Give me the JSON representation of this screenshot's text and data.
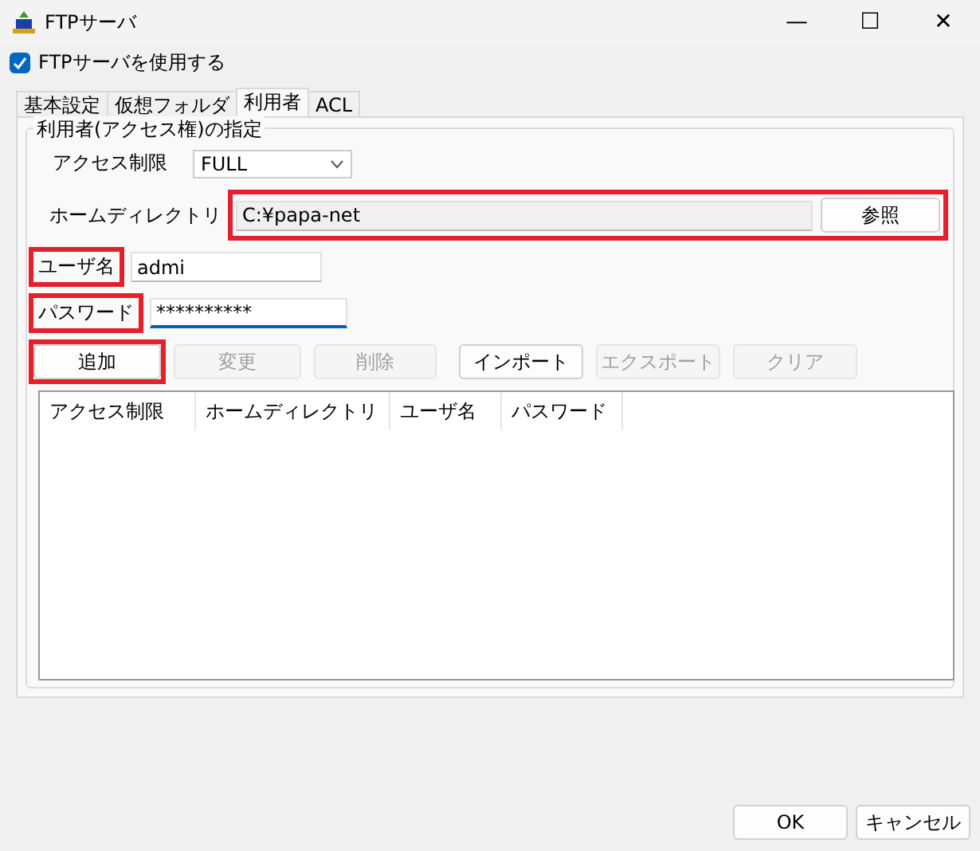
{
  "window": {
    "title": "FTPサーバ",
    "minimize": "—",
    "maximize": "☐",
    "close": "✕"
  },
  "enable": {
    "label": "FTPサーバを使用する",
    "checked": true
  },
  "tabs": [
    {
      "label": "基本設定",
      "selected": false
    },
    {
      "label": "仮想フォルダ",
      "selected": false
    },
    {
      "label": "利用者",
      "selected": true
    },
    {
      "label": "ACL",
      "selected": false
    }
  ],
  "group": {
    "title": "利用者(アクセス権)の指定",
    "access": {
      "label": "アクセス制限",
      "value": "FULL"
    },
    "home": {
      "label": "ホームディレクトリ",
      "value": "C:¥papa-net",
      "button": "参照",
      "highlighted": true
    },
    "user": {
      "label": "ユーザ名",
      "value": "admi",
      "highlighted": true
    },
    "password": {
      "label": "パスワード",
      "value": "**********",
      "focused": true,
      "highlighted": true
    },
    "buttons": [
      {
        "label": "追加",
        "disabled": false,
        "highlighted": true
      },
      {
        "label": "変更",
        "disabled": true,
        "highlighted": false
      },
      {
        "label": "削除",
        "disabled": true,
        "highlighted": false
      },
      {
        "label": "インポート",
        "disabled": false,
        "highlighted": false
      },
      {
        "label": "エクスポート",
        "disabled": true,
        "highlighted": false
      },
      {
        "label": "クリア",
        "disabled": true,
        "highlighted": false
      }
    ],
    "table": {
      "columns": [
        "アクセス制限",
        "ホームディレクトリ",
        "ユーザ名",
        "パスワード"
      ]
    }
  },
  "footer": {
    "ok": "OK",
    "cancel": "キャンセル"
  }
}
